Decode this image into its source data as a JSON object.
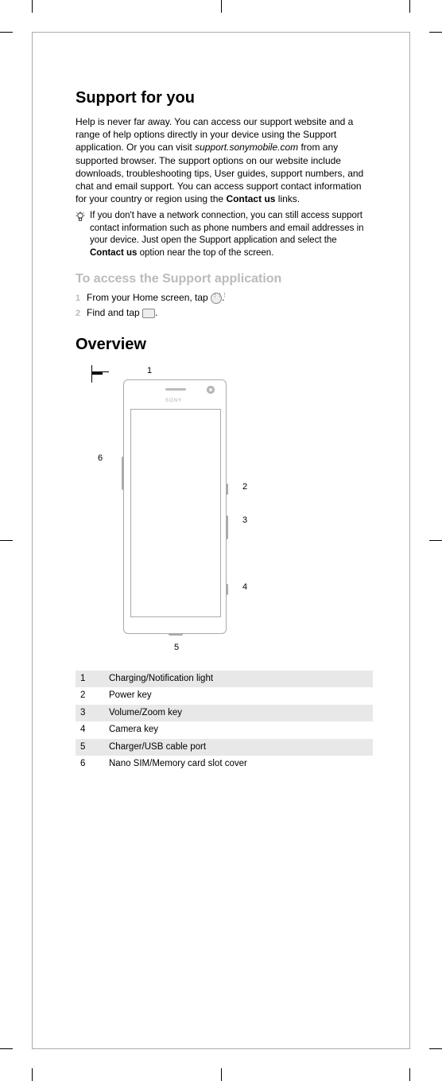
{
  "heading_support": "Support for you",
  "para_support_1a": "Help is never far away. You can access our support website and a range of help options directly in your device using the Support application. Or you can visit ",
  "para_support_1_link": "support.sonymobile.com",
  "para_support_1b": " from any supported browser. The support options on our website include downloads, troubleshooting tips, User guides, support numbers, and chat and email support. You can access support contact information for your country or region using the ",
  "para_support_1_bold1": "Contact us",
  "para_support_1c": " links.",
  "tip_text_a": "If you don't have a network connection, you can still access support contact information such as phone numbers and email addresses in your device. Just open the Support application and select the ",
  "tip_text_bold": "Contact us",
  "tip_text_b": " option near the top of the screen.",
  "heading_access": "To access the Support application",
  "step1_num": "1",
  "step1_text_a": "From your Home screen, tap ",
  "step1_text_b": ".",
  "step2_num": "2",
  "step2_text_a": "Find and tap ",
  "step2_text_b": ".",
  "heading_overview": "Overview",
  "phone_logo": "SONY",
  "label_1": "1",
  "label_2": "2",
  "label_3": "3",
  "label_4": "4",
  "label_5": "5",
  "label_6": "6",
  "parts": [
    {
      "num": "1",
      "label": "Charging/Notification light"
    },
    {
      "num": "2",
      "label": "Power key"
    },
    {
      "num": "3",
      "label": "Volume/Zoom key"
    },
    {
      "num": "4",
      "label": "Camera key"
    },
    {
      "num": "5",
      "label": "Charger/USB cable port"
    },
    {
      "num": "6",
      "label": "Nano SIM/Memory card slot cover"
    }
  ]
}
